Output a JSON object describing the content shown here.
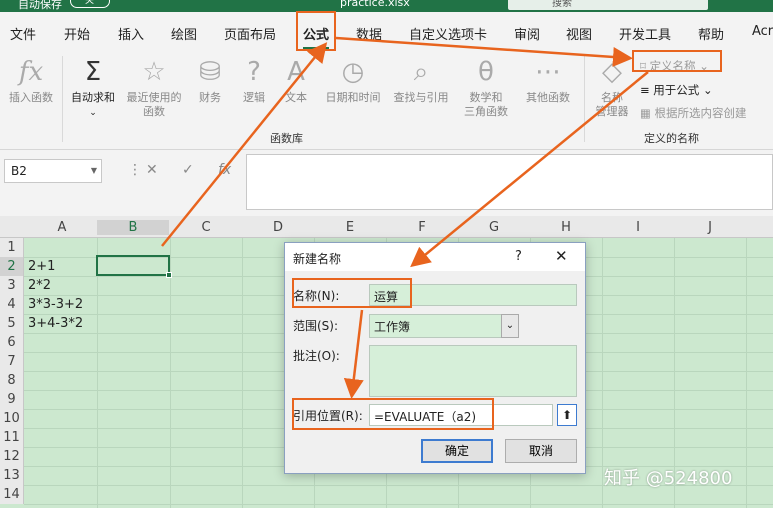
{
  "titlebar": {
    "autosave": "自动保存",
    "toggle": "关",
    "file": "practice.xlsx",
    "search": "搜索"
  },
  "tabs": [
    "文件",
    "开始",
    "插入",
    "绘图",
    "页面布局",
    "公式",
    "数据",
    "自定义选项卡",
    "审阅",
    "视图",
    "开发工具",
    "帮助",
    "Acr"
  ],
  "ribbon": {
    "insert_function": "插入函数",
    "autosum": "自动求和",
    "recent": [
      "最近使用的",
      "函数"
    ],
    "finance": "财务",
    "logic": "逻辑",
    "text": "文本",
    "datetime": "日期和时间",
    "lookup": "查找与引用",
    "math": [
      "数学和",
      "三角函数"
    ],
    "other": "其他函数",
    "library_label": "函数库",
    "name_manager": [
      "名称",
      "管理器"
    ],
    "define_name": "定义名称",
    "use_in_formula": "用于公式",
    "create_from_selection": "根据所选内容创建",
    "defined_names_label": "定义的名称"
  },
  "formula_bar": {
    "name_box": "B2"
  },
  "grid": {
    "columns": [
      "A",
      "B",
      "C",
      "D",
      "E",
      "F",
      "G",
      "H",
      "I",
      "J"
    ],
    "rows": [
      "1",
      "2",
      "3",
      "4",
      "5",
      "6",
      "7",
      "8",
      "9",
      "10",
      "11",
      "12",
      "13",
      "14"
    ],
    "col_a": [
      "",
      "2+1",
      "2*2",
      "3*3-3+2",
      "3+4-3*2"
    ]
  },
  "dialog": {
    "title": "新建名称",
    "help": "?",
    "close": "✕",
    "name_label": "名称(N):",
    "name_value": "运算",
    "scope_label": "范围(S):",
    "scope_value": "工作簿",
    "comment_label": "批注(O):",
    "refers_label": "引用位置(R):",
    "refers_value": "=EVALUATE（a2)",
    "ok": "确定",
    "cancel": "取消"
  },
  "watermark": "知乎 @524800",
  "colors": {
    "accent": "#217346",
    "highlight": "#e8641e",
    "sheet_bg": "#cce8cf"
  }
}
